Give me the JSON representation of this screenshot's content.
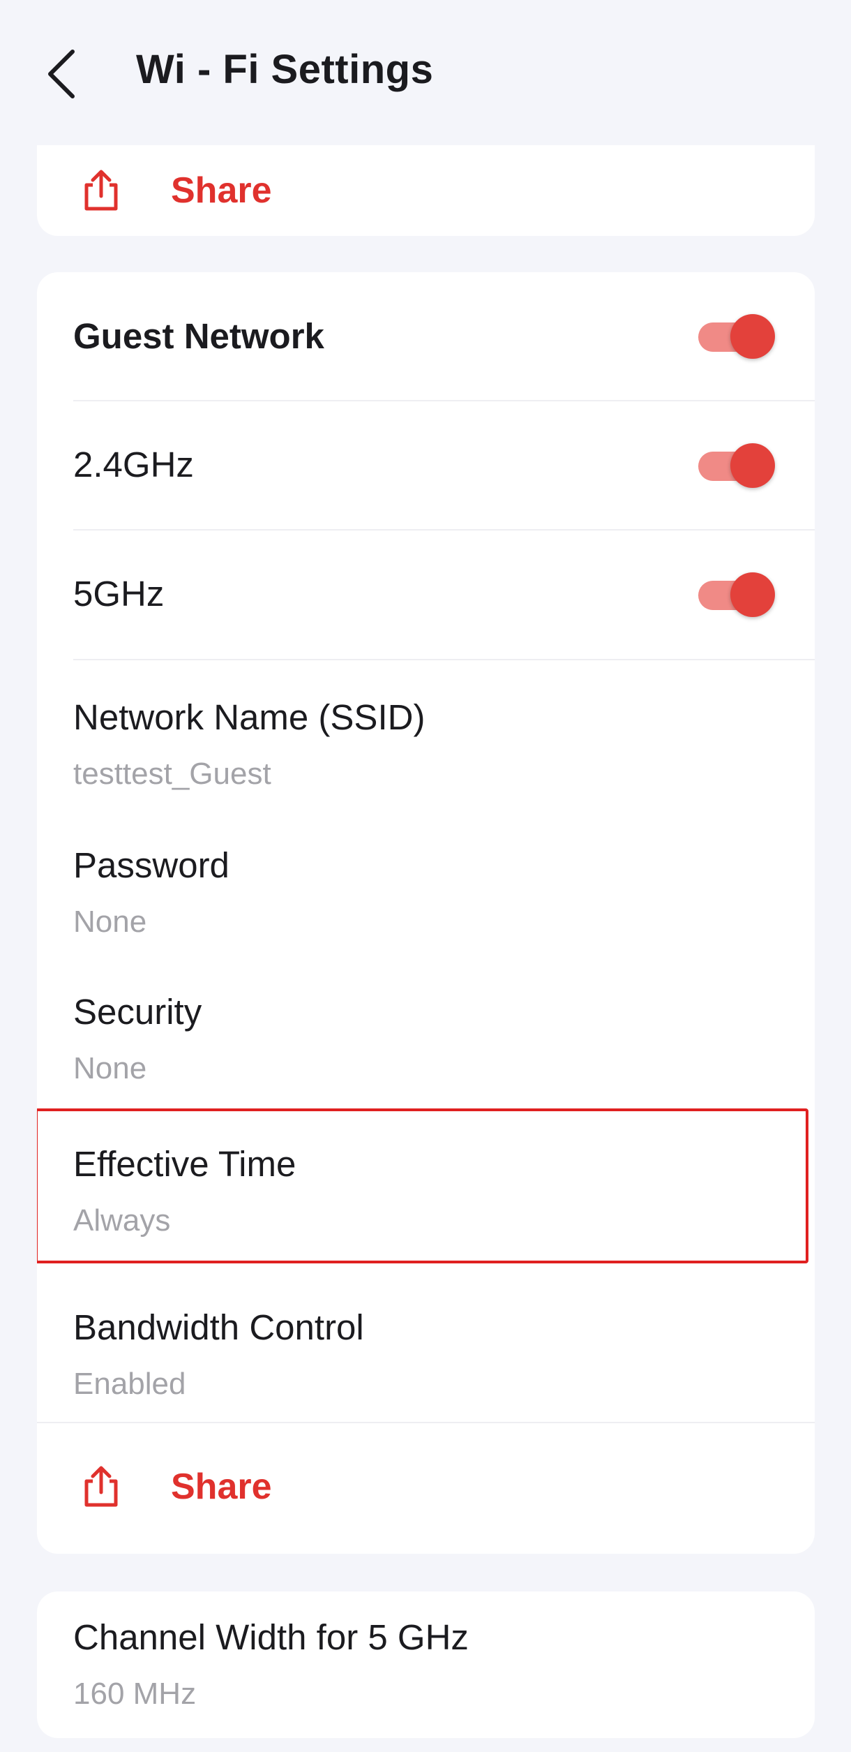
{
  "header": {
    "title": "Wi - Fi Settings",
    "back_icon": "chevron-left-icon"
  },
  "top_card": {
    "share_label": "Share",
    "share_icon": "share-icon"
  },
  "guest_card": {
    "guest_network": {
      "label": "Guest Network",
      "enabled": true
    },
    "band_24": {
      "label": "2.4GHz",
      "enabled": true
    },
    "band_5": {
      "label": "5GHz",
      "enabled": true
    },
    "ssid": {
      "label": "Network Name (SSID)",
      "value": "testtest_Guest"
    },
    "password": {
      "label": "Password",
      "value": "None"
    },
    "security": {
      "label": "Security",
      "value": "None"
    },
    "effective_time": {
      "label": "Effective Time",
      "value": "Always"
    },
    "bandwidth_control": {
      "label": "Bandwidth Control",
      "value": "Enabled"
    },
    "share_label": "Share"
  },
  "channel_card": {
    "label": "Channel Width for 5 GHz",
    "value": "160 MHz"
  },
  "colors": {
    "accent": "#e0312d",
    "toggle_track": "#f08a86",
    "toggle_thumb": "#e3413b",
    "highlight": "#e02020",
    "background": "#f4f5fa"
  }
}
